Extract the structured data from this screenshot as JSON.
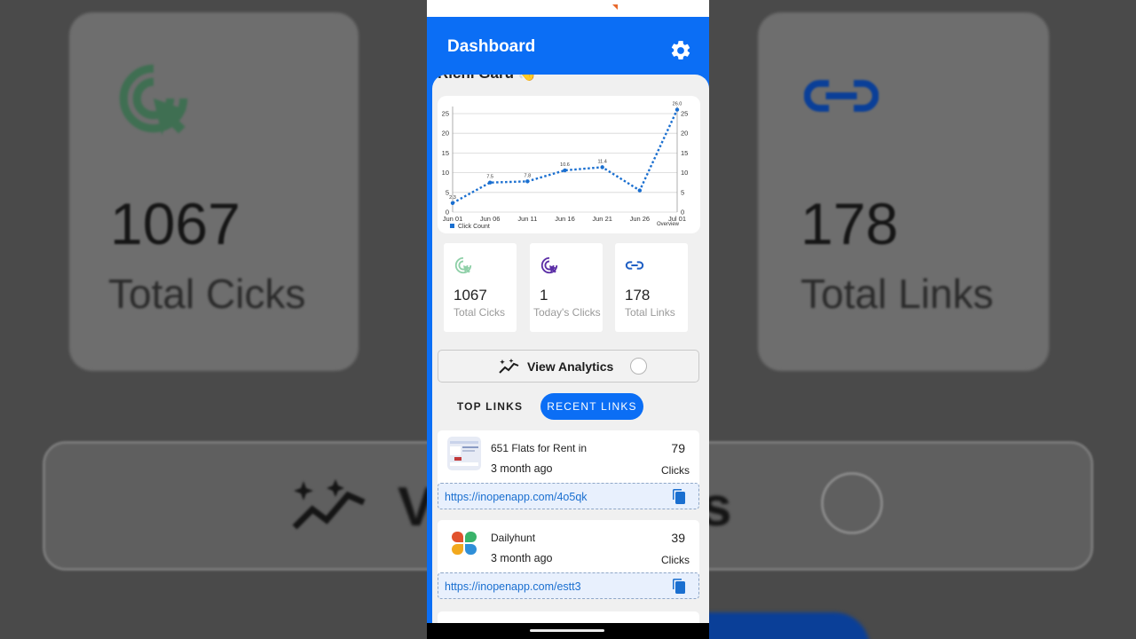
{
  "background": {
    "stat_left_value": "1067",
    "stat_left_label": "Total Cicks",
    "stat_right_value": "178",
    "stat_right_label": "Total Links",
    "analytics_text": "V",
    "analytics_text_tail": "s"
  },
  "appbar": {
    "title": "Dashboard",
    "settings_icon": "gear-icon"
  },
  "greeting": {
    "text": "Ricnl Garu",
    "emoji": "👋"
  },
  "chart_data": {
    "type": "line",
    "categories": [
      "Jun 01",
      "Jun 06",
      "Jun 11",
      "Jun 16",
      "Jun 21",
      "Jun 26",
      "Jul 01"
    ],
    "x": [
      "Jun 01",
      "Jun 06",
      "Jun 11",
      "Jun 16",
      "Jun 21",
      "Jun 26",
      "Jul 01"
    ],
    "series": [
      {
        "name": "Click Count",
        "values": [
          2.3,
          7.5,
          7.8,
          10.6,
          11.4,
          5.5,
          26.0
        ],
        "labels": [
          "2.3",
          "7.5",
          "7.8",
          "10.6",
          "11.4",
          "",
          "26.0"
        ]
      }
    ],
    "ylim": [
      0,
      25
    ],
    "yticks": [
      "0",
      "5",
      "10",
      "15",
      "20",
      "25"
    ],
    "legend": "Click Count",
    "legend_position": "bottom-left",
    "footer_label": "Overview",
    "grid": true,
    "line_color": "#1a6fd0"
  },
  "stats": [
    {
      "value": "1067",
      "label": "Total Cicks",
      "icon": "cursor-click-icon",
      "color": "#8fd0a8"
    },
    {
      "value": "1",
      "label": "Today's Clicks",
      "icon": "cursor-click-icon",
      "color": "#5b2ea6"
    },
    {
      "value": "178",
      "label": "Total Links",
      "icon": "link-icon",
      "color": "#1f5fc4"
    }
  ],
  "analytics": {
    "label": "View Analytics",
    "icon": "sparkle-trend-icon"
  },
  "tabs": [
    {
      "label": "TOP LINKS",
      "active": false
    },
    {
      "label": "RECENT LINKS",
      "active": true
    }
  ],
  "links": [
    {
      "title": "651   Flats for Rent in",
      "ago": "3 month ago",
      "clicks": "79",
      "clicks_label": "Clicks",
      "url": "https://inopenapp.com/4o5qk",
      "thumb": "webpage-thumbnail"
    },
    {
      "title": "Dailyhunt",
      "ago": "3 month ago",
      "clicks": "39",
      "clicks_label": "Clicks",
      "url": "https://inopenapp.com/estt3",
      "thumb": "dailyhunt-logo"
    }
  ]
}
